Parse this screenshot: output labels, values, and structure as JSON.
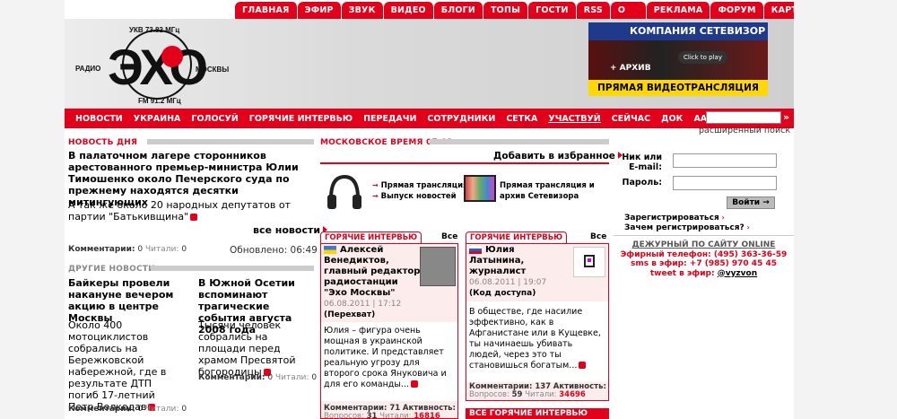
{
  "top_nav": [
    "ГЛАВНАЯ",
    "ЭФИР",
    "ЗВУК",
    "ВИДЕО",
    "БЛОГИ",
    "ТОПЫ",
    "ГОСТИ",
    "RSS",
    "О НАС",
    "РЕКЛАМА",
    "ФОРУМ",
    "КАРТА"
  ],
  "logo": {
    "radio": "РАДИО",
    "big": "ЭХО",
    "moskvy": "МОСКВЫ",
    "ukv": "УКВ 73.82 МГц",
    "fm": "FM 91.2 МГц"
  },
  "banner": {
    "title": "КОМПАНИЯ СЕТЕВИЗОР",
    "play": "Click to play",
    "archive": "+ АРХИВ",
    "bottom": "ПРЯМАЯ ВИДЕОТРАНСЛЯЦИЯ"
  },
  "main_nav": [
    "НОВОСТИ",
    "УКРАИНА",
    "ГОЛОСУЙ",
    "ГОРЯЧИЕ ИНТЕРВЬЮ",
    "ПЕРЕДАЧИ",
    "СОТРУДНИКИ",
    "СЕТКА",
    "УЧАСТВУЙ",
    "СЕЙЧАС",
    "ДОК",
    "ААВ"
  ],
  "search": {
    "go": "»",
    "extended": "расширенный поиск"
  },
  "news_day": {
    "head": "НОВОСТЬ ДНЯ",
    "title": "В палаточном лагере сторонников арестованного премьер-министра Юлии Тимошенко около Печерского суда по прежнему находятся десятки митингующих",
    "sub": "А так же около 20 народных депутатов от партии \"Батькивщина\"",
    "all": "все новости",
    "comments": "Комментарии:",
    "comments_n": "0",
    "readers": "Читали:",
    "readers_n": "0",
    "updated": "Обновлено: 06:49"
  },
  "other_news": {
    "head": "ДРУГИЕ НОВОСТИ",
    "items": [
      {
        "title": "Байкеры провели накануне вечером акцию в центре Москвы",
        "text": "Около 400 мотоциклистов собрались на Бережковской набережной, где в результате ДТП погиб 17-летний Петр Волкодав",
        "comments": "Комментарии:",
        "comments_n": "0",
        "readers": "Читали:",
        "readers_n": "0"
      },
      {
        "title": "В Южной Осетии вспоминают трагические события августа 2008 года",
        "text": "Тысячи человек собрались на площади перед храмом Пресвятой богородицы",
        "comments": "Комментарии:",
        "comments_n": "0",
        "readers": "Читали:",
        "readers_n": "0"
      }
    ]
  },
  "center": {
    "time": "МОСКОВСКОЕ ВРЕМЯ 07:02",
    "fav": "Добавить в избранное",
    "live": "Прямая трансляция",
    "news_release": "Выпуск новостей",
    "live2": "Прямая трансляция и архив Сетевизора"
  },
  "interviews": [
    {
      "tab": "ГОРЯЧИЕ ИНТЕРВЬЮ",
      "all": "Все",
      "name": "Алексей Венедиктов, главный редактор радиостанции \"Эхо Москвы\"",
      "date": "06.08.2011 | 17:12",
      "show": "Перехват",
      "text": "Юлия – фигура очень мощная в украинской политике. И представляет реальную угрозу для второго срока Януковича и для его команды...",
      "comments": "Комментарии: 71",
      "activity": "Активность:",
      "questions": "Вопросов:",
      "questions_n": "31",
      "readers": "Читали:",
      "readers_n": "16816"
    },
    {
      "tab": "ГОРЯЧИЕ ИНТЕРВЬЮ",
      "all": "Все",
      "name": "Юлия Латынина, журналист",
      "date": "06.08.2011 | 19:07",
      "show": "Код доступа",
      "text": "В обществе, где насилие эффективно, как в Афганистане или в Кущевке, ты начинаешь убивать людей, через это ты становишься богатым...",
      "comments": "Комментарии: 137",
      "activity": "Активность:",
      "questions": "Вопросов:",
      "questions_n": "59",
      "readers": "Читали:",
      "readers_n": "34696"
    }
  ],
  "all_interviews": "ВСЕ ГОРЯЧИЕ ИНТЕРВЬЮ",
  "login": {
    "nick": "Ник или E-mail:",
    "password": "Пароль:",
    "enter": "Войти →",
    "register": "Зарегистрироваться",
    "why": "Зачем регистрироваться?"
  },
  "duty": {
    "title": "ДЕЖУРНЫЙ ПО САЙТУ ONLINE",
    "phone": "Эфирный телефон: (495) 363-36-59",
    "sms": "sms в эфир: +7 (985) 970 45 45",
    "tweet": "tweet в эфир:",
    "handle": "@vyzvon"
  },
  "colors": {
    "brand_red": "#e2001a",
    "pink_bg": "#fdecec",
    "gray_bar": "#cccccc"
  }
}
